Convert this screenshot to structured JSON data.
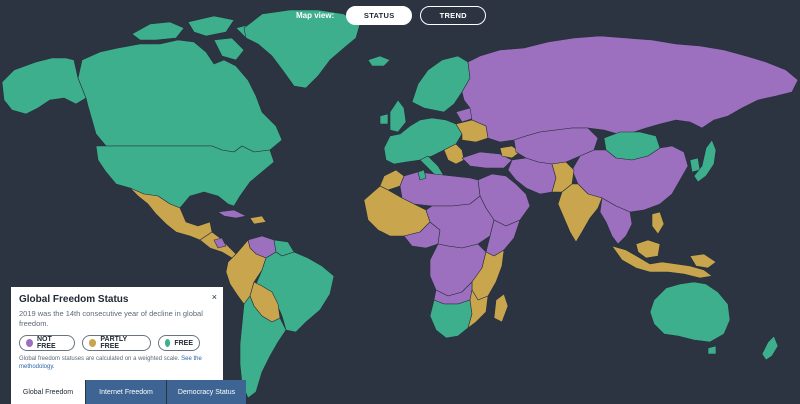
{
  "map": {
    "colors": {
      "background": "#2b3440",
      "not_free": "#9d6fbf",
      "partly_free": "#c9a64e",
      "free": "#3daf8c",
      "border": "#27303b"
    }
  },
  "mapview": {
    "label": "Map view:",
    "buttons": [
      "STATUS",
      "TREND"
    ],
    "selected": "STATUS"
  },
  "panel": {
    "title": "Global Freedom Status",
    "close": "×",
    "description": "2019 was the 14th consecutive year of decline in global freedom.",
    "legend": {
      "not_free": "NOT FREE",
      "partly_free": "PARTLY FREE",
      "free": "FREE"
    },
    "note": "Global freedom statuses are calculated on a weighted scale.",
    "note_link": "See the methodology."
  },
  "tabs": [
    "Global Freedom",
    "Internet Freedom",
    "Democracy Status"
  ],
  "active_tab": "Global Freedom"
}
